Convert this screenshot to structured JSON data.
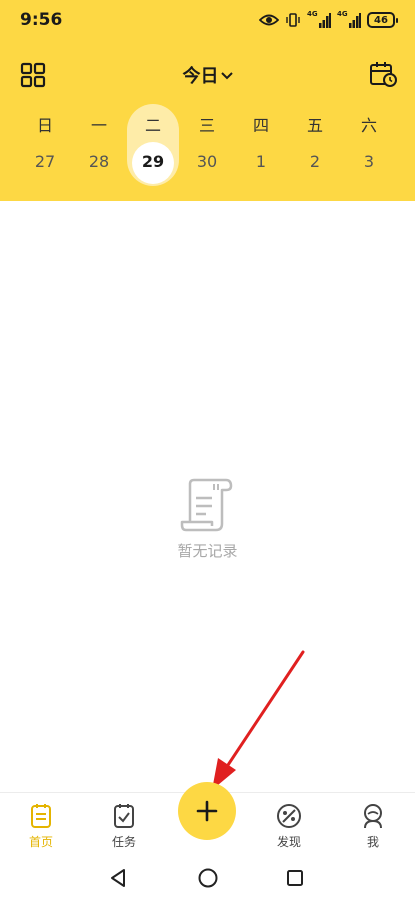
{
  "status_bar": {
    "time": "9:56",
    "signal_1": "4G",
    "signal_2": "4G",
    "battery": "46"
  },
  "header": {
    "title": "今日"
  },
  "week": {
    "days": [
      "日",
      "一",
      "二",
      "三",
      "四",
      "五",
      "六"
    ],
    "dates": [
      "27",
      "28",
      "29",
      "30",
      "1",
      "2",
      "3"
    ],
    "selected_index": 2
  },
  "empty_state": {
    "text": "暂无记录"
  },
  "tabs": [
    {
      "label": "首页",
      "icon": "notes-icon",
      "active": true
    },
    {
      "label": "任务",
      "icon": "task-check-icon",
      "active": false
    },
    {
      "label": "发现",
      "icon": "palette-icon",
      "active": false
    },
    {
      "label": "我",
      "icon": "profile-icon",
      "active": false
    }
  ],
  "fab": {
    "icon": "plus-icon"
  },
  "colors": {
    "accent": "#FDD844",
    "accent_light": "#FEECA8",
    "active_tab": "#E4B400",
    "annotation_arrow": "#E02020"
  }
}
